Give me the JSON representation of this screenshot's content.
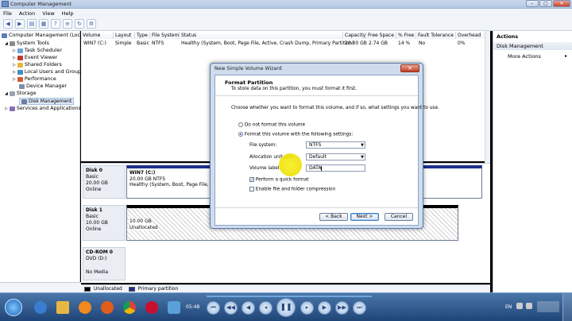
{
  "window": {
    "title": "Computer Management",
    "min": "–",
    "max": "▢",
    "close": "✕"
  },
  "menu": [
    "File",
    "Action",
    "View",
    "Help"
  ],
  "tree": {
    "root": "Computer Management (Local",
    "system_tools": "System Tools",
    "task_scheduler": "Task Scheduler",
    "event_viewer": "Event Viewer",
    "shared_folders": "Shared Folders",
    "local_users": "Local Users and Groups",
    "performance": "Performance",
    "device_manager": "Device Manager",
    "storage": "Storage",
    "disk_management": "Disk Management",
    "services": "Services and Applications"
  },
  "volume_table": {
    "headers": [
      "Volume",
      "Layout",
      "Type",
      "File System",
      "Status",
      "Capacity",
      "Free Space",
      "% Free",
      "Fault Tolerance",
      "Overhead"
    ],
    "row": [
      "WIN7 (C:)",
      "Simple",
      "Basic",
      "NTFS",
      "Healthy (System, Boot, Page File, Active, Crash Dump, Primary Partition)",
      "20.00 GB",
      "2.74 GB",
      "14 %",
      "No",
      "0%"
    ]
  },
  "disks": {
    "disk0": {
      "name": "Disk 0",
      "type": "Basic",
      "size": "20.00 GB",
      "state": "Online",
      "part_name": "WIN7 (C:)",
      "part_size": "20.00 GB NTFS",
      "part_status": "Healthy (System, Boot, Page File, Acti"
    },
    "disk1": {
      "name": "Disk 1",
      "type": "Basic",
      "size": "10.00 GB",
      "state": "Online",
      "part_size": "10.00 GB",
      "part_status": "Unallocated"
    },
    "cdrom": {
      "name": "CD-ROM 0",
      "type": "DVD (D:)",
      "state": "No Media"
    }
  },
  "legend": {
    "unallocated": "Unallocated",
    "primary": "Primary partition"
  },
  "actions": {
    "header": "Actions",
    "section": "Disk Management",
    "more": "More Actions"
  },
  "wizard": {
    "title": "New Simple Volume Wizard",
    "heading": "Format Partition",
    "subheading": "To store data on this partition, you must format it first.",
    "prompt": "Choose whether you want to format this volume, and if so, what settings you want to use.",
    "opt_no": "Do not format this volume",
    "opt_yes": "Format this volume with the following settings:",
    "fs_label": "File system:",
    "fs_value": "NTFS",
    "alloc_label": "Allocation unit size:",
    "alloc_value": "Default",
    "vol_label": "Volume label:",
    "vol_value": "DATA",
    "quick_format": "Perform a quick format",
    "compression": "Enable file and folder compression",
    "back": "< Back",
    "next": "Next >",
    "cancel": "Cancel"
  },
  "taskbar": {
    "time_elapsed": "05:48",
    "lang": "EN"
  },
  "colors": {
    "primary_partition": "#1d2e8a",
    "unallocated": "#000000",
    "highlight": "#f2e60b"
  }
}
